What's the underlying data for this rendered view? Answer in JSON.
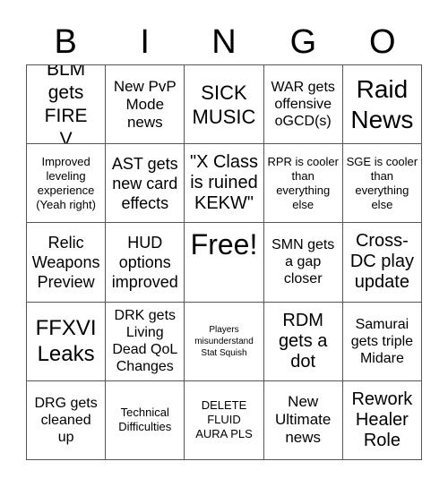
{
  "header": {
    "letters": [
      "B",
      "I",
      "N",
      "G",
      "O"
    ]
  },
  "cells": [
    "BLM gets FIRE V",
    "New PvP Mode news",
    "SICK MUSIC",
    "WAR gets offensive oGCD(s)",
    "Raid News",
    "Improved leveling experience (Yeah right)",
    "AST gets new card effects",
    "\"X Class is ruined KEKW\"",
    "RPR is cooler than everything else",
    "SGE is cooler than everything else",
    "Relic Weapons Preview",
    "HUD options improved",
    "Free!",
    "SMN gets a gap closer",
    "Cross-DC play update",
    "FFXVI Leaks",
    "DRK gets Living Dead QoL Changes",
    "Players misunderstand Stat Squish",
    "RDM gets a dot",
    "Samurai gets triple Midare",
    "DRG gets cleaned up",
    "Technical Difficulties",
    "DELETE FLUID AURA PLS",
    "New Ultimate news",
    "Rework Healer Role"
  ]
}
